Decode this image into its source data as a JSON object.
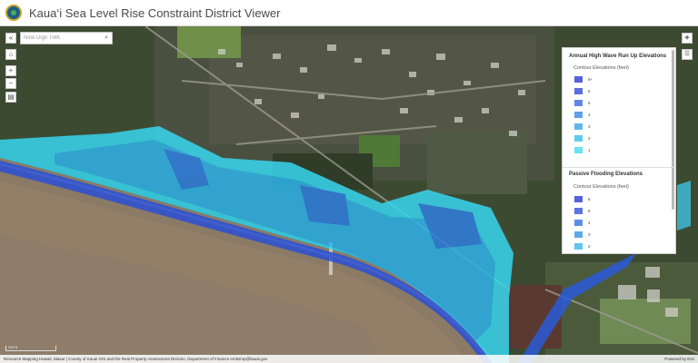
{
  "header": {
    "title": "Kaua‘i Sea Level Rise Constraint District Viewer"
  },
  "search": {
    "placeholder": "Nine Digit TMK"
  },
  "legend": {
    "section1": {
      "title": "Annual High Wave Run Up Elevations",
      "subtitle": "Contour Elevations (feet)",
      "items": [
        "6+",
        "5",
        "5",
        "4",
        "3",
        "2",
        "1"
      ],
      "colors": [
        "#5562d9",
        "#5a6ee0",
        "#5d86e6",
        "#5e9eea",
        "#5fb6ee",
        "#60ccef",
        "#67e3f2"
      ]
    },
    "section2": {
      "title": "Passive Flooding Elevations",
      "subtitle": "Contour Elevations (feet)",
      "items": [
        "6",
        "5",
        "4",
        "3",
        "2"
      ],
      "colors": [
        "#5562d9",
        "#5a74e0",
        "#5d8ee6",
        "#5eaaea",
        "#60c6ee"
      ]
    }
  },
  "map": {
    "scale_label": "300 ft",
    "attribution": "Resource Mapping Hawaii, Maxar | County of Kauai GIS and the Real Property Assessment Division, Department of Finance ernksmp@kauai.gov",
    "powered_by": "Powered by Esri"
  },
  "colors": {
    "flood_light": "#3ee0f0",
    "flood_mid": "#2aa7e6",
    "flood_dark": "#2f56d6",
    "ocean": "#8b7a66"
  }
}
